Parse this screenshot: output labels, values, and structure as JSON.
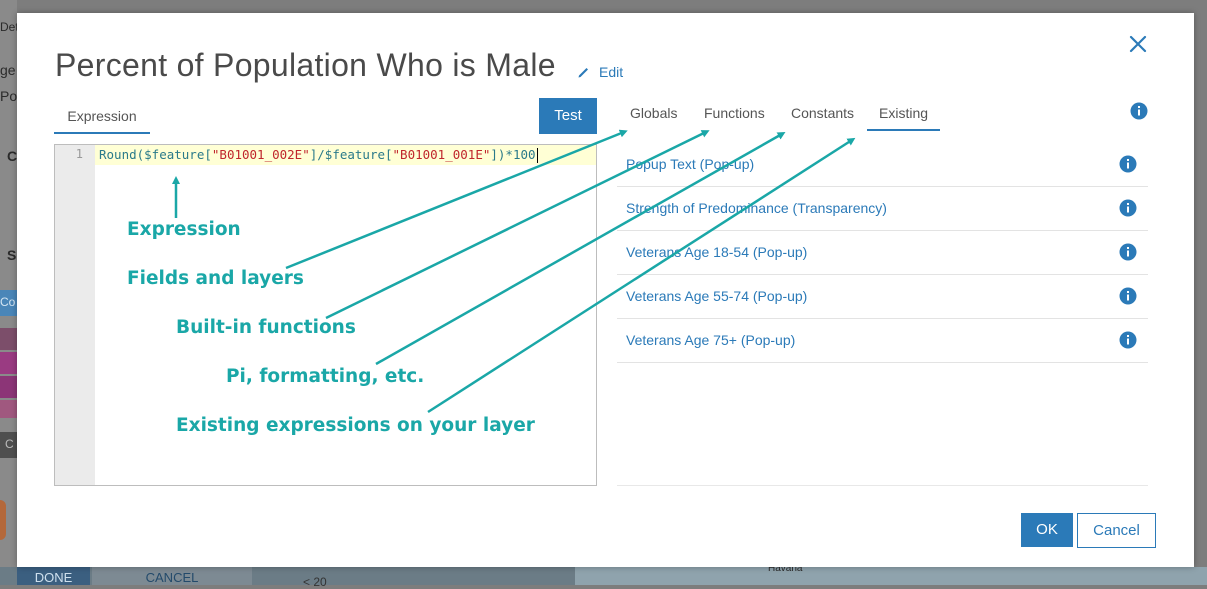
{
  "background": {
    "left_texts": [
      "Det",
      "ge",
      "Po",
      "C",
      "S",
      "Co",
      "C"
    ],
    "done_label": "DONE",
    "cancel_label": "CANCEL",
    "map_label": "Havana",
    "range_label": "< 20"
  },
  "dialog": {
    "title": "Percent of Population Who is Male",
    "edit_label": "Edit"
  },
  "editor": {
    "tab_label": "Expression",
    "test_label": "Test",
    "line_number": "1",
    "code": {
      "fn": "Round(",
      "p1": "$feature[",
      "s1": "\"B01001_002E\"",
      "p2": "]/",
      "p3": "$feature[",
      "s2": "\"B01001_001E\"",
      "p4": "])*100"
    }
  },
  "annotations": {
    "expression": "Expression",
    "fields": "Fields and layers",
    "functions": "Built-in functions",
    "constants": "Pi, formatting, etc.",
    "existing": "Existing expressions on your layer"
  },
  "tabs": {
    "globals": "Globals",
    "functions": "Functions",
    "constants": "Constants",
    "existing": "Existing"
  },
  "existing_list": [
    "Popup Text (Pop-up)",
    "Strength of Predominance (Transparency)",
    "Veterans Age 18-54 (Pop-up)",
    "Veterans Age 55-74 (Pop-up)",
    "Veterans Age 75+ (Pop-up)"
  ],
  "footer": {
    "ok_label": "OK",
    "cancel_label": "Cancel"
  },
  "colors": {
    "accent": "#2b7ab8",
    "annotation": "#1aa7a7"
  }
}
